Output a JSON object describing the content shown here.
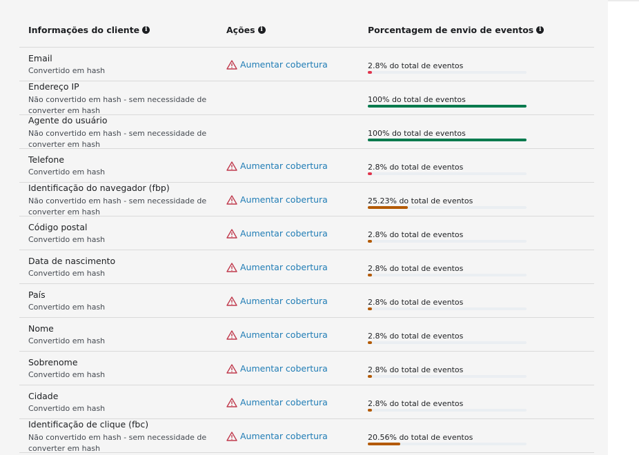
{
  "header": {
    "col1": "Informações do cliente",
    "col2": "Ações",
    "col3": "Porcentagem de envio de eventos"
  },
  "colors": {
    "good": "#007a4d",
    "bad": "#e0344c",
    "warn_bar": "#b35900",
    "warning_icon": "#c0394c",
    "link": "#1f7cb5"
  },
  "rows": [
    {
      "name": "Email",
      "sub": "Convertido em hash",
      "action": "Aumentar cobertura",
      "pct_label": "2.8% do total de eventos",
      "pct": 2.8,
      "bar_color": "bad"
    },
    {
      "name": "Endereço IP",
      "sub": "Não convertido em hash - sem necessidade de converter em hash",
      "action": "",
      "pct_label": "100% do total de eventos",
      "pct": 100,
      "bar_color": "good"
    },
    {
      "name": "Agente do usuário",
      "sub": "Não convertido em hash - sem necessidade de converter em hash",
      "action": "",
      "pct_label": "100% do total de eventos",
      "pct": 100,
      "bar_color": "good"
    },
    {
      "name": "Telefone",
      "sub": "Convertido em hash",
      "action": "Aumentar cobertura",
      "pct_label": "2.8% do total de eventos",
      "pct": 2.8,
      "bar_color": "bad"
    },
    {
      "name": "Identificação do navegador (fbp)",
      "sub": "Não convertido em hash - sem necessidade de converter em hash",
      "action": "Aumentar cobertura",
      "pct_label": "25.23% do total de eventos",
      "pct": 25.23,
      "bar_color": "warn_bar"
    },
    {
      "name": "Código postal",
      "sub": "Convertido em hash",
      "action": "Aumentar cobertura",
      "pct_label": "2.8% do total de eventos",
      "pct": 2.8,
      "bar_color": "warn_bar"
    },
    {
      "name": "Data de nascimento",
      "sub": "Convertido em hash",
      "action": "Aumentar cobertura",
      "pct_label": "2.8% do total de eventos",
      "pct": 2.8,
      "bar_color": "warn_bar"
    },
    {
      "name": "País",
      "sub": "Convertido em hash",
      "action": "Aumentar cobertura",
      "pct_label": "2.8% do total de eventos",
      "pct": 2.8,
      "bar_color": "warn_bar"
    },
    {
      "name": "Nome",
      "sub": "Convertido em hash",
      "action": "Aumentar cobertura",
      "pct_label": "2.8% do total de eventos",
      "pct": 2.8,
      "bar_color": "warn_bar"
    },
    {
      "name": "Sobrenome",
      "sub": "Convertido em hash",
      "action": "Aumentar cobertura",
      "pct_label": "2.8% do total de eventos",
      "pct": 2.8,
      "bar_color": "warn_bar"
    },
    {
      "name": "Cidade",
      "sub": "Convertido em hash",
      "action": "Aumentar cobertura",
      "pct_label": "2.8% do total de eventos",
      "pct": 2.8,
      "bar_color": "warn_bar"
    },
    {
      "name": "Identificação de clique (fbc)",
      "sub": "Não convertido em hash - sem necessidade de converter em hash",
      "action": "Aumentar cobertura",
      "pct_label": "20.56% do total de eventos",
      "pct": 20.56,
      "bar_color": "warn_bar"
    }
  ]
}
